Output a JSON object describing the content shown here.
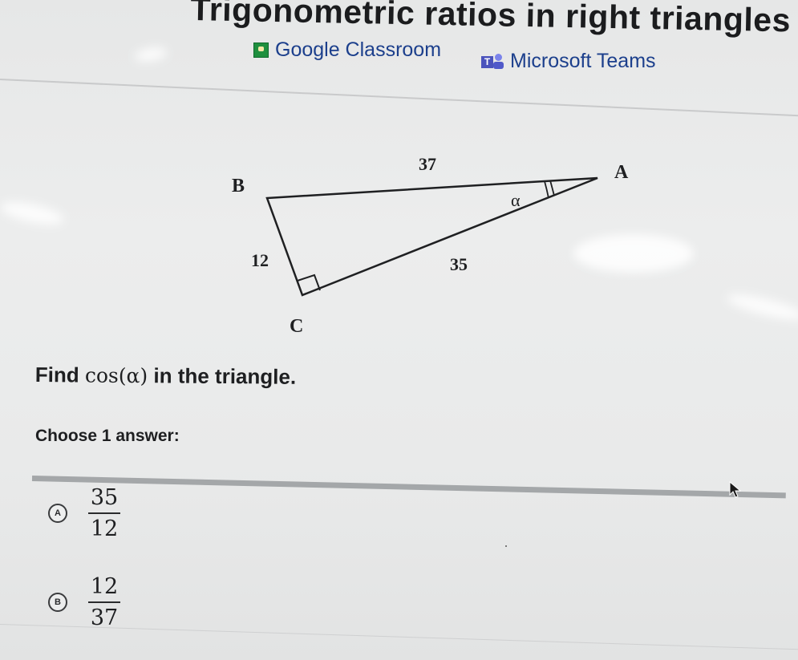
{
  "page": {
    "title": "Trigonometric ratios in right triangles"
  },
  "share": {
    "google_classroom": "Google Classroom",
    "microsoft_teams": "Microsoft Teams"
  },
  "diagram": {
    "vertices": {
      "A": "A",
      "B": "B",
      "C": "C"
    },
    "angle_label": "α",
    "sides": {
      "hypotenuse_AB": "37",
      "leg_BC": "12",
      "leg_CA": "35"
    }
  },
  "question": {
    "prefix": "Find ",
    "expression": "cos(α)",
    "suffix": " in the triangle."
  },
  "prompt": {
    "choose_label": "Choose 1 answer:"
  },
  "options": [
    {
      "letter": "A",
      "numerator": "35",
      "denominator": "12"
    },
    {
      "letter": "B",
      "numerator": "12",
      "denominator": "37"
    }
  ]
}
